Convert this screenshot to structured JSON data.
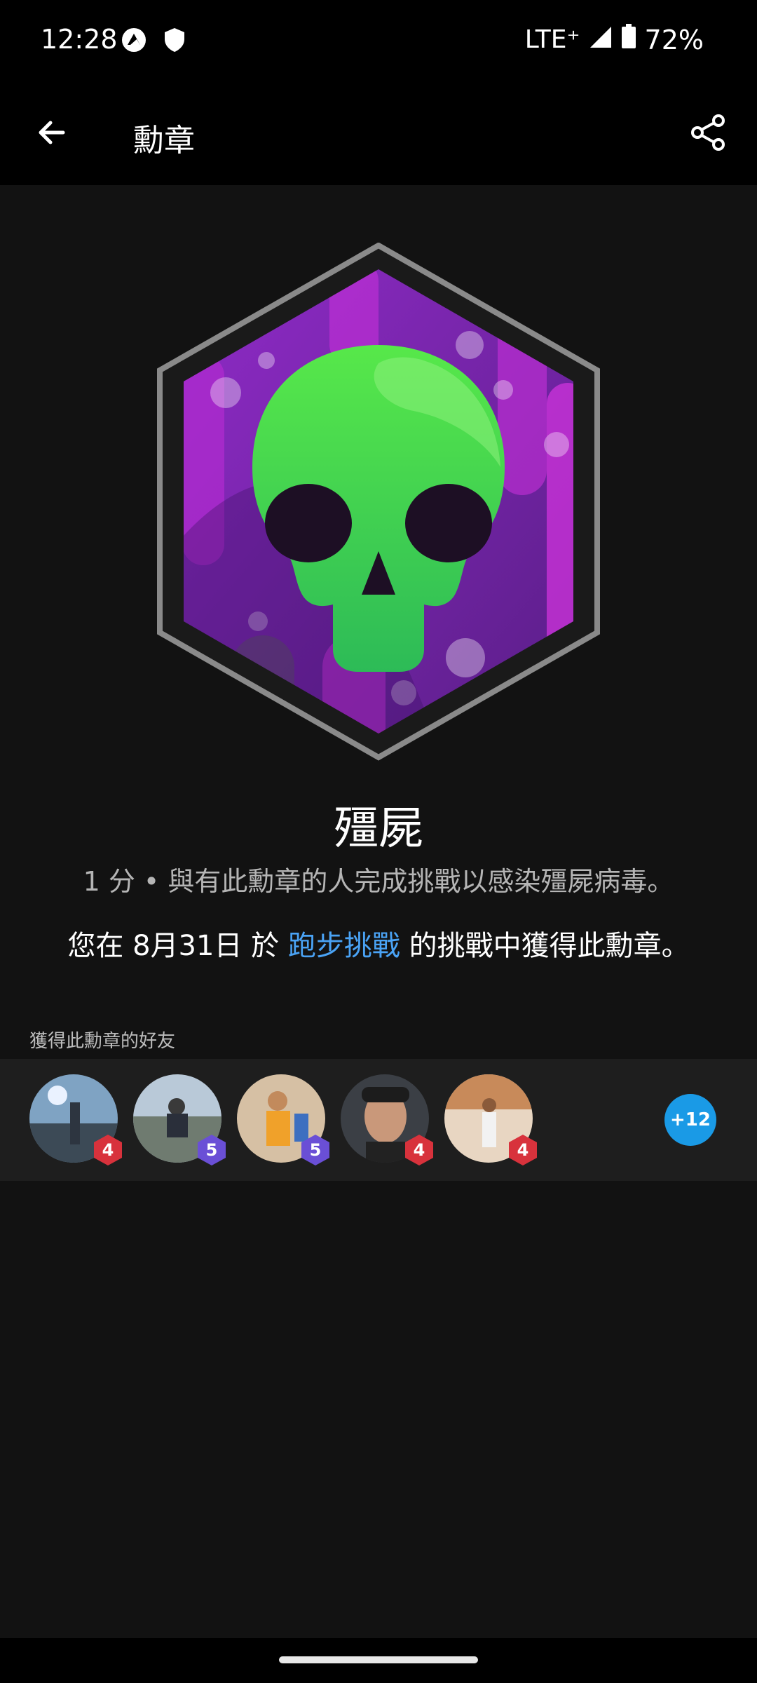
{
  "status_bar": {
    "time": "12:28",
    "network": "LTE⁺",
    "battery": "72%",
    "icons": [
      "notification-app-icon",
      "shield-icon",
      "signal-icon",
      "battery-icon"
    ]
  },
  "app_bar": {
    "title": "勳章",
    "back_icon": "arrow-left-icon",
    "share_icon": "share-icon"
  },
  "badge": {
    "name": "殭屍",
    "description": "1 分 • 與有此勳章的人完成挑戰以感染殭屍病毒。",
    "earned_prefix": "您在 8月31日 於 ",
    "earned_link": "跑步挑戰",
    "earned_suffix": " 的挑戰中獲得此勳章。",
    "colors": {
      "frame": "#8a8a8a",
      "background": "#7a24a6",
      "skull": "#3fd24a"
    }
  },
  "friends": {
    "label": "獲得此勳章的好友",
    "items": [
      {
        "level": "4",
        "level_color": "#d8323c",
        "avatar_tone": "#5b7a96"
      },
      {
        "level": "5",
        "level_color": "#6a4fd6",
        "avatar_tone": "#7d8a78"
      },
      {
        "level": "5",
        "level_color": "#6a4fd6",
        "avatar_tone": "#c9853a"
      },
      {
        "level": "4",
        "level_color": "#d8323c",
        "avatar_tone": "#4a4e54"
      },
      {
        "level": "4",
        "level_color": "#d8323c",
        "avatar_tone": "#c8a27a"
      }
    ],
    "more_label": "+12"
  }
}
